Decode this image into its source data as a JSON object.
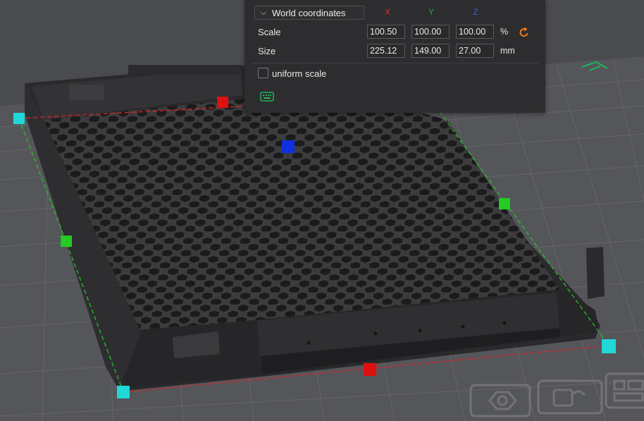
{
  "panel": {
    "coordinate_system": "World coordinates",
    "axes": [
      {
        "label": "X",
        "color": "#e03030"
      },
      {
        "label": "Y",
        "color": "#2ea84a"
      },
      {
        "label": "Z",
        "color": "#3b5bd6"
      }
    ],
    "scale": {
      "label": "Scale",
      "x": "100.50",
      "y": "100.00",
      "z": "100.00",
      "unit": "%"
    },
    "size": {
      "label": "Size",
      "x": "225.12",
      "y": "149.00",
      "z": "27.00",
      "unit": "mm"
    },
    "uniform_scale": {
      "label": "uniform scale",
      "checked": false
    },
    "icons": {
      "reset": "reset-arrow-icon",
      "keyboard": "keyboard-icon"
    }
  },
  "toolbar": {
    "icons": [
      "nut-icon",
      "unlock-icon",
      "layout-icon"
    ]
  },
  "colors": {
    "accent_orange": "#f07b1e",
    "accent_green": "#1fb35a",
    "handle_red": "#e01010",
    "handle_green": "#22cc22",
    "handle_blue": "#1030e0",
    "handle_cyan": "#20d8d8"
  }
}
